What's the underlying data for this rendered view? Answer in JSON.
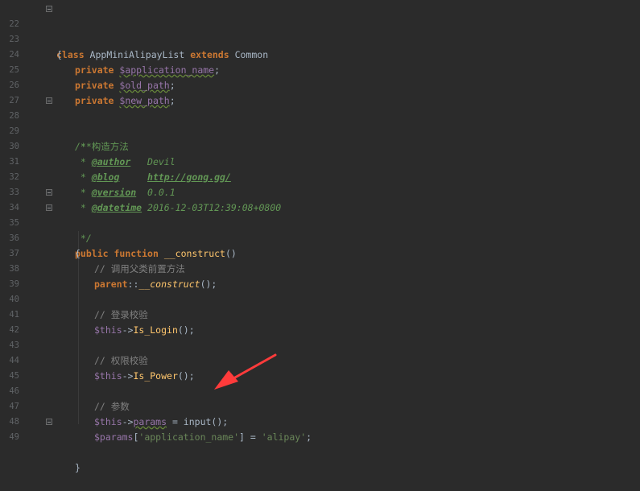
{
  "editor": {
    "line_numbers": [
      "22",
      "23",
      "24",
      "25",
      "26",
      "27",
      "28",
      "29",
      "30",
      "31",
      "32",
      "33",
      "34",
      "35",
      "36",
      "37",
      "38",
      "39",
      "40",
      "41",
      "42",
      "43",
      "44",
      "45",
      "46",
      "47",
      "48",
      "49"
    ],
    "gutter_icons": [
      "override-method-icon",
      "up-arrow-icon"
    ],
    "colors": {
      "background": "#2b2b2b",
      "keyword": "#cc7832",
      "variable": "#9876aa",
      "doc_comment": "#629755",
      "comment": "#808080",
      "string": "#6a8759",
      "annotation_arrow": "#ff3b3b"
    },
    "lines": {
      "l22": {
        "kw1": "class",
        "t1": " AppMiniAlipayList ",
        "kw2": "extends",
        "t2": " Common"
      },
      "l23": {
        "t1": "{"
      },
      "l24": {
        "kw1": "private",
        "sp": " ",
        "var1": "$application_name",
        "semi": ";"
      },
      "l25": {
        "kw1": "private",
        "sp": " ",
        "var1": "$old_path",
        "semi": ";"
      },
      "l26": {
        "kw1": "private",
        "sp": " ",
        "var1": "$new_path",
        "semi": ";"
      },
      "l28": {
        "doc": "/**"
      },
      "l29": {
        "doc": " * 构造方法"
      },
      "l30": {
        "star": " * ",
        "tag": "@author",
        "rest": "   Devil"
      },
      "l31": {
        "star": " * ",
        "tag": "@blog",
        "sp": "     ",
        "link": "http://gong.gg/"
      },
      "l32": {
        "star": " * ",
        "tag": "@version",
        "rest": "  0.0.1"
      },
      "l33": {
        "star": " * ",
        "tag": "@datetime",
        "rest": " 2016-12-03T12:39:08+0800"
      },
      "l34": {
        "doc": " */"
      },
      "l35": {
        "kw1": "public",
        "sp": " ",
        "kw2": "function",
        "sp2": " ",
        "fn": "__construct",
        "t1": "()"
      },
      "l36": {
        "t1": "{"
      },
      "l37": {
        "cm": "// 调用父类前置方法"
      },
      "l38": {
        "kw1": "parent",
        "t1": "::",
        "fn": "__construct",
        "t2": "();"
      },
      "l40": {
        "cm": "// 登录校验"
      },
      "l41": {
        "var1": "$this",
        "t1": "->",
        "fn": "Is_Login",
        "t2": "();"
      },
      "l43": {
        "cm": "// 权限校验"
      },
      "l44": {
        "var1": "$this",
        "t1": "->",
        "fn": "Is_Power",
        "t2": "();"
      },
      "l46": {
        "cm": "// 参数"
      },
      "l47": {
        "var1": "$this",
        "t1": "->",
        "var2": "params",
        "t2": " = input();"
      },
      "l48": {
        "var1": "$params",
        "t1": "[",
        "str": "'application_name'",
        "t2": "] = ",
        "str2": "'alipay'",
        "t3": ";"
      },
      "l49": {
        "t1": "}"
      }
    }
  }
}
